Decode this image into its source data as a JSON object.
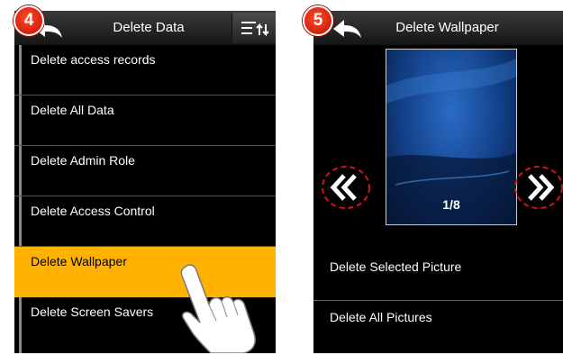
{
  "step_left": "4",
  "step_right": "5",
  "left_screen": {
    "title": "Delete Data",
    "items": [
      {
        "label": "Delete access records"
      },
      {
        "label": "Delete All Data"
      },
      {
        "label": "Delete Admin Role"
      },
      {
        "label": "Delete Access Control"
      },
      {
        "label": "Delete Wallpaper",
        "selected": true
      },
      {
        "label": "Delete Screen Savers"
      }
    ]
  },
  "right_screen": {
    "title": "Delete Wallpaper",
    "counter": "1/8",
    "items": [
      {
        "label": "Delete Selected Picture"
      },
      {
        "label": "Delete All Pictures"
      }
    ]
  },
  "colors": {
    "highlight": "#ffb300",
    "badge": "#e0260f",
    "annotation": "#d0141a"
  },
  "icons": [
    "back-arrow-icon",
    "sort-icon",
    "double-left-chevron-icon",
    "double-right-chevron-icon",
    "hand-pointer-icon"
  ]
}
